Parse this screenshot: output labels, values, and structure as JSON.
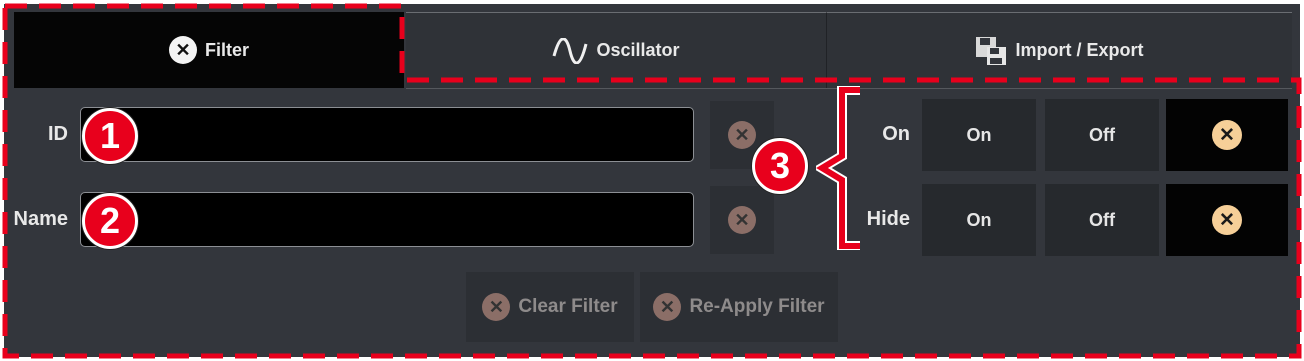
{
  "tabs": [
    {
      "label": "Filter",
      "icon": "close-circle-icon",
      "active": true
    },
    {
      "label": "Oscillator",
      "icon": "sine-wave-icon",
      "active": false
    },
    {
      "label": "Import / Export",
      "icon": "save-disk-icon",
      "active": false
    }
  ],
  "fields": {
    "id_label": "ID",
    "id_value": "",
    "name_label": "Name",
    "name_value": ""
  },
  "toggles": {
    "on_label": "On",
    "hide_label": "Hide",
    "on_option": "On",
    "off_option": "Off"
  },
  "actions": {
    "clear_filter": "Clear Filter",
    "reapply_filter": "Re-Apply Filter"
  },
  "annotations": [
    "1",
    "2",
    "3"
  ],
  "colors": {
    "annotation_red": "#e8001c",
    "panel": "#33363c",
    "active_tab": "#050505",
    "clear_icon_active": "#f6cf98"
  }
}
